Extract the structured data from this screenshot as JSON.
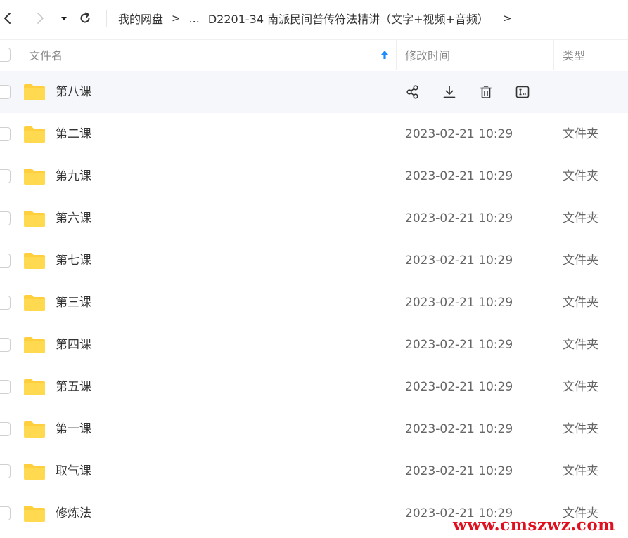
{
  "navbar": {
    "icons": [
      "back-arrow-icon",
      "forward-arrow-icon",
      "history-dropdown-icon",
      "refresh-icon"
    ],
    "breadcrumb": [
      "我的网盘",
      "...",
      "D2201-34 南派民间普传符法精讲（文字+视频+音频）"
    ],
    "separator": ">"
  },
  "table": {
    "headers": {
      "name": "文件名",
      "mtime": "修改时间",
      "type": "类型"
    },
    "sort_icon": "sort-ascending-arrow-icon",
    "rows": [
      {
        "name": "第八课",
        "mtime": "",
        "type": "",
        "hovered": true
      },
      {
        "name": "第二课",
        "mtime": "2023-02-21 10:29",
        "type": "文件夹"
      },
      {
        "name": "第九课",
        "mtime": "2023-02-21 10:29",
        "type": "文件夹"
      },
      {
        "name": "第六课",
        "mtime": "2023-02-21 10:29",
        "type": "文件夹"
      },
      {
        "name": "第七课",
        "mtime": "2023-02-21 10:29",
        "type": "文件夹"
      },
      {
        "name": "第三课",
        "mtime": "2023-02-21 10:29",
        "type": "文件夹"
      },
      {
        "name": "第四课",
        "mtime": "2023-02-21 10:29",
        "type": "文件夹"
      },
      {
        "name": "第五课",
        "mtime": "2023-02-21 10:29",
        "type": "文件夹"
      },
      {
        "name": "第一课",
        "mtime": "2023-02-21 10:29",
        "type": "文件夹"
      },
      {
        "name": "取气课",
        "mtime": "2023-02-21 10:29",
        "type": "文件夹"
      },
      {
        "name": "修炼法",
        "mtime": "2023-02-21 10:29",
        "type": "文件夹"
      }
    ],
    "row_actions": [
      "share-icon",
      "download-icon",
      "delete-icon",
      "rename-icon"
    ]
  },
  "colors": {
    "accent": "#1a8cff",
    "folder": "#ffcf3e",
    "hover_row": "#f6f7fa",
    "watermark": "#e0101e"
  },
  "watermark": "www.cmszwz.com"
}
